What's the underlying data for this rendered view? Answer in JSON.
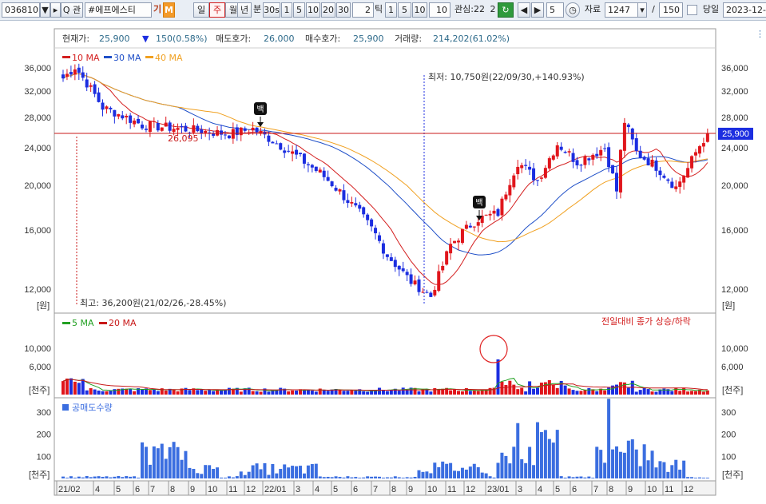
{
  "toolbar": {
    "code": "036810",
    "search_label": "Q 관",
    "name": "#에프에스티",
    "gi_label": "기",
    "m_label": "M",
    "periods": [
      "일",
      "주",
      "월",
      "년",
      "분"
    ],
    "active_period": "주",
    "interval_a": "30s",
    "minute_btns": [
      "1",
      "5",
      "10",
      "20",
      "30"
    ],
    "tick_value": "2",
    "tick_label": "틱",
    "tick_btns": [
      "1",
      "5",
      "10"
    ],
    "tick_input": "10",
    "interest_label": "관심:22",
    "interest_value": "2",
    "step_value": "5",
    "data_label": "자료",
    "data_count": "1247",
    "data_sep": "/",
    "data_total": "150",
    "day_label": "당일",
    "date": "2023-12-"
  },
  "header": {
    "price_label": "현재가:",
    "price": "25,900",
    "change_arrow": "▼",
    "change": "150(0.58%)",
    "ask_label": "매도호가:",
    "ask": "26,000",
    "bid_label": "매수호가:",
    "bid": "25,900",
    "volume_label": "거래량:",
    "volume": "214,202(61.02%)"
  },
  "colors": {
    "up": "#e0161c",
    "down": "#1c2ee0",
    "ma10": "#d42020",
    "ma30": "#2050c8",
    "ma40": "#f0a020",
    "ma5_vol": "#22a022",
    "ma20_vol": "#c81818",
    "short_bar": "#3b6ee0",
    "price_line": "#c81818",
    "price_tag": "#1c2ee0"
  },
  "price_panel": {
    "legend": [
      {
        "label": "10 MA",
        "color": "#d42020"
      },
      {
        "label": "30 MA",
        "color": "#2050c8"
      },
      {
        "label": "40 MA",
        "color": "#f0a020"
      }
    ],
    "y_ticks": [
      "36,000",
      "32,000",
      "28,000",
      "24,000",
      "20,000",
      "16,000",
      "12,000"
    ],
    "unit": "[원]",
    "current_tag": "25,900",
    "min_annotation": "최저: 10,750원(22/09/30,+140.93%)",
    "max_annotation": "최고: 36,200원(21/02/26,-28.45%)",
    "level_label": "26,095",
    "marker_label": "백"
  },
  "volume_panel": {
    "legend": [
      {
        "label": "5 MA",
        "color": "#22a022"
      },
      {
        "label": "20 MA",
        "color": "#c81818"
      }
    ],
    "y_ticks": [
      "10,000",
      "6,000"
    ],
    "unit": "[천주]",
    "note": "전일대비 종가 상승/하락"
  },
  "short_panel": {
    "legend": [
      {
        "label": "공매도수량",
        "color": "#3b6ee0"
      }
    ],
    "y_ticks": [
      "300",
      "200",
      "100"
    ],
    "unit": "[천주]"
  },
  "x_axis": {
    "labels": [
      "21/02",
      "4",
      "5",
      "6",
      "7",
      "8",
      "9",
      "10",
      "11",
      "12",
      "22/01",
      "3",
      "4",
      "5",
      "6",
      "7",
      "8",
      "9",
      "10",
      "11",
      "12",
      "23/01",
      "3",
      "4",
      "5",
      "6",
      "7",
      "8",
      "9",
      "10",
      "11",
      "12"
    ]
  },
  "chart_data": {
    "type": "candlestick",
    "title": "",
    "xlabel": "",
    "ylabel": "원",
    "x_start": "21/02",
    "x_end": "23/12",
    "ylim": [
      10000,
      38000
    ],
    "price_checkpoints": [
      {
        "week": 0,
        "close": 34200
      },
      {
        "week": 3,
        "close": 36200
      },
      {
        "week": 10,
        "close": 29500
      },
      {
        "week": 20,
        "close": 27000
      },
      {
        "week": 30,
        "close": 26500
      },
      {
        "week": 42,
        "close": 25800
      },
      {
        "week": 48,
        "close": 26500
      },
      {
        "week": 55,
        "close": 24300
      },
      {
        "week": 65,
        "close": 21300
      },
      {
        "week": 75,
        "close": 17500
      },
      {
        "week": 82,
        "close": 14300
      },
      {
        "week": 88,
        "close": 12500
      },
      {
        "week": 93,
        "close": 11500
      },
      {
        "week": 98,
        "close": 15000
      },
      {
        "week": 105,
        "close": 17000
      },
      {
        "week": 110,
        "close": 17500
      },
      {
        "week": 115,
        "close": 22500
      },
      {
        "week": 120,
        "close": 20500
      },
      {
        "week": 125,
        "close": 24500
      },
      {
        "week": 130,
        "close": 22500
      },
      {
        "week": 137,
        "close": 24000
      },
      {
        "week": 140,
        "close": 19500
      },
      {
        "week": 142,
        "close": 27500
      },
      {
        "week": 145,
        "close": 23500
      },
      {
        "week": 150,
        "close": 22000
      },
      {
        "week": 155,
        "close": 19800
      },
      {
        "week": 158,
        "close": 21800
      },
      {
        "week": 160,
        "close": 23500
      },
      {
        "week": 163,
        "close": 25900
      }
    ],
    "current_price": 25900,
    "reference_level": 26095,
    "max": {
      "value": 36200,
      "date": "21/02/26"
    },
    "min": {
      "value": 10750,
      "date": "22/09/30"
    }
  }
}
